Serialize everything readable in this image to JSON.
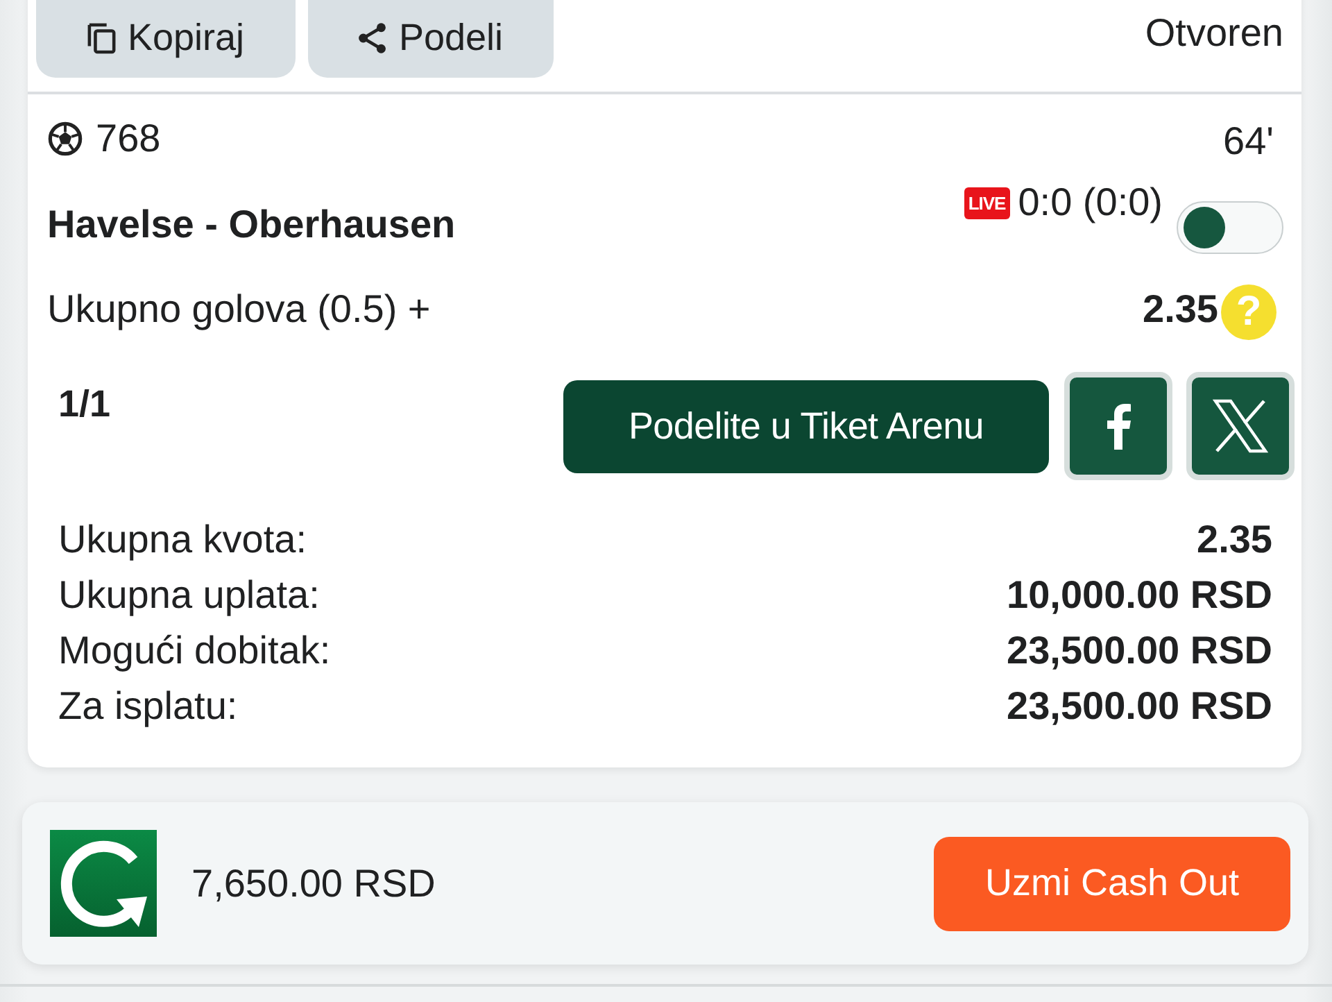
{
  "toolbar": {
    "buttons": [
      {
        "kind": "copy",
        "label": "Kopiraj"
      },
      {
        "kind": "share",
        "label": "Podeli"
      }
    ],
    "status": "Otvoren"
  },
  "match": {
    "code": "768",
    "minute": "64'",
    "teams": "Havelse - Oberhausen",
    "live_badge": "LIVE",
    "score": "0:0 (0:0)",
    "toggle": {
      "on": false
    },
    "market": "Ukupno golova (0.5) +",
    "odds": "2.35",
    "help": "?"
  },
  "ticket": {
    "count": "1/1",
    "share_button": "Podelite u Tiket Arenu",
    "social": [
      {
        "kind": "facebook"
      },
      {
        "kind": "x"
      }
    ]
  },
  "summary": [
    {
      "label": "Ukupna kvota:",
      "value": "2.35"
    },
    {
      "label": "Ukupna uplata:",
      "value": "10,000.00 RSD"
    },
    {
      "label": "Mogući dobitak:",
      "value": "23,500.00 RSD"
    },
    {
      "label": "Za isplatu:",
      "value": "23,500.00 RSD"
    }
  ],
  "cash_out": {
    "amount": "7,650.00 RSD",
    "button": "Uzmi Cash Out"
  }
}
